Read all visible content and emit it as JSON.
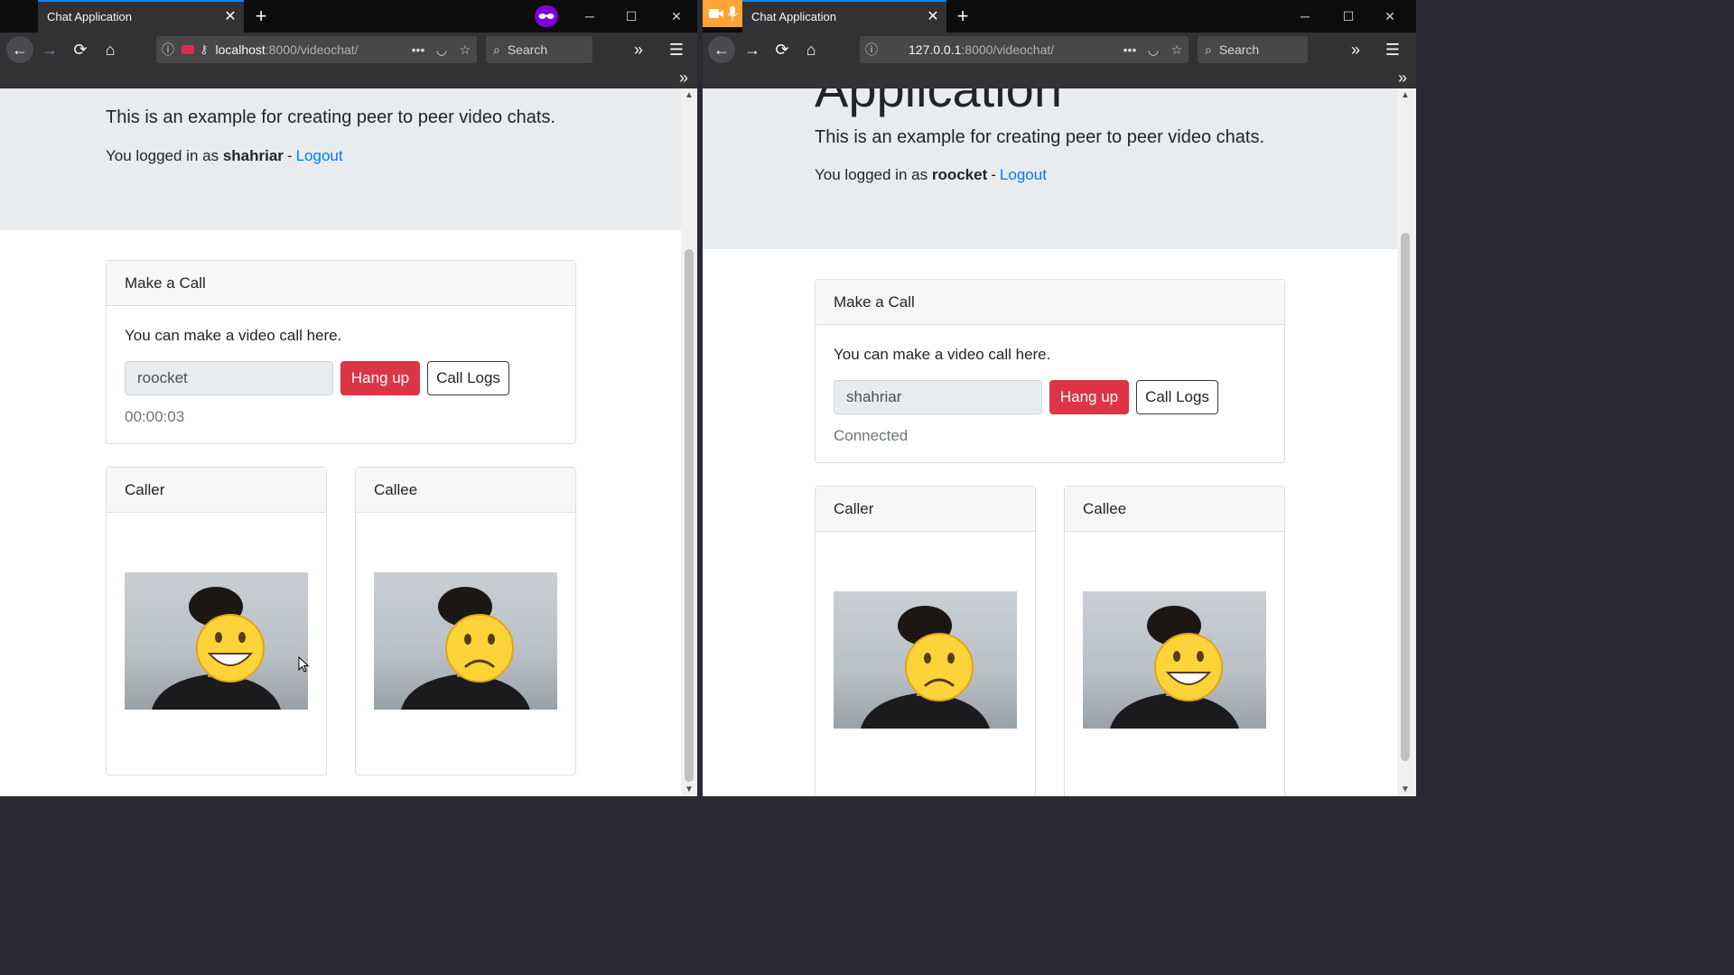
{
  "left": {
    "tab_title": "Chat Application",
    "url_host": "localhost",
    "url_rest": ":8000/videochat/",
    "search_placeholder": "Search",
    "lead": "This is an example for creating peer to peer video chats.",
    "logged_prefix": "You logged in as",
    "username": "shahriar",
    "separator": "-",
    "logout": "Logout",
    "make_call": {
      "title": "Make a Call",
      "text": "You can make a video call here.",
      "peer_value": "roocket",
      "hangup_label": "Hang up",
      "logs_label": "Call Logs",
      "status": "00:00:03"
    },
    "caller_title": "Caller",
    "callee_title": "Callee"
  },
  "right": {
    "tab_title": "Chat Application",
    "url_host": "127.0.0.1",
    "url_rest": ":8000/videochat/",
    "search_placeholder": "Search",
    "heading_fragment": "Application",
    "lead": "This is an example for creating peer to peer video chats.",
    "logged_prefix": "You logged in as",
    "username": "roocket",
    "separator": "-",
    "logout": "Logout",
    "make_call": {
      "title": "Make a Call",
      "text": "You can make a video call here.",
      "peer_value": "shahriar",
      "hangup_label": "Hang up",
      "logs_label": "Call Logs",
      "status": "Connected"
    },
    "caller_title": "Caller",
    "callee_title": "Callee"
  },
  "icons": {
    "back": "←",
    "forward": "→",
    "reload": "⟳",
    "home": "⌂",
    "info": "ⓘ",
    "more": "•••",
    "pocket": "◡",
    "star": "☆",
    "search": "⌕",
    "overflow": "»",
    "menu": "☰",
    "close": "✕",
    "plus": "+",
    "minimize": "─",
    "maximize": "☐",
    "scroll_up": "▲",
    "scroll_down": "▼"
  },
  "colors": {
    "accent": "#0a84ff",
    "danger": "#dc3545",
    "link": "#007bff",
    "jumbotron": "#e9ecef"
  }
}
